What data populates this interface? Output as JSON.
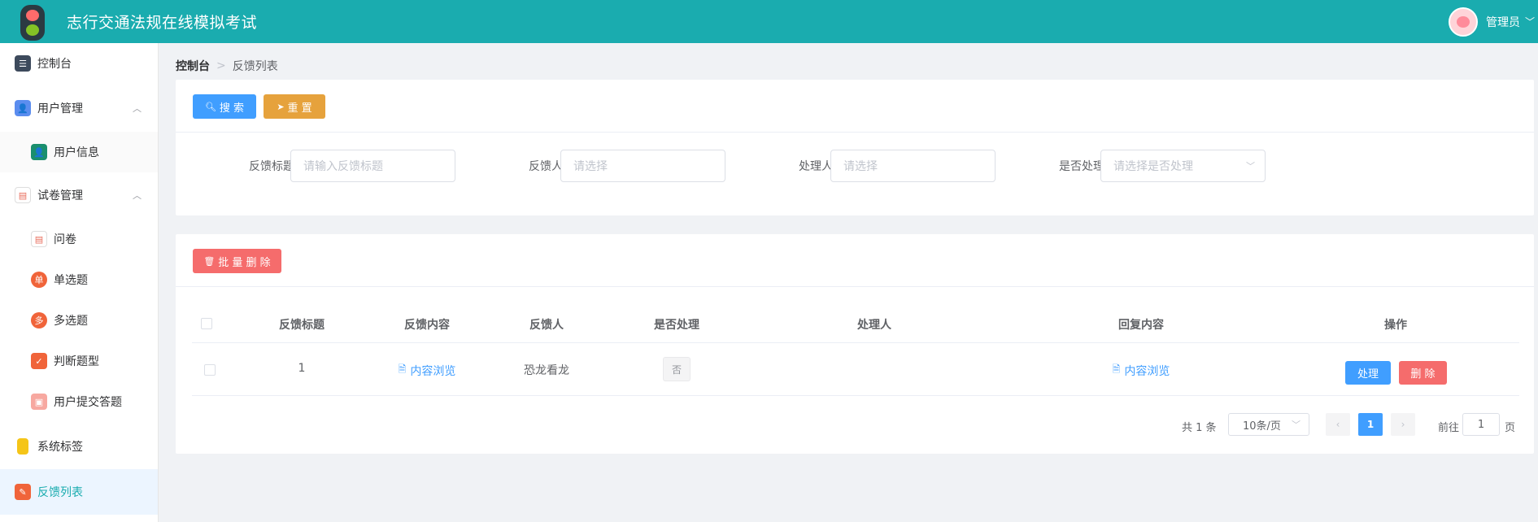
{
  "header": {
    "app_title": "志行交通法规在线模拟考试",
    "user_name": "管理员",
    "user_chevron": "﹀"
  },
  "sidebar": {
    "items": [
      {
        "label": "控制台",
        "icon": "dashboard-icon",
        "icon_color": "#3d4a5c"
      },
      {
        "label": "用户管理",
        "icon": "user-group-icon",
        "icon_color": "#5b8def",
        "arrow": "︿"
      },
      {
        "label": "用户信息",
        "icon": "user-card-icon",
        "icon_color": "#1a8f6e"
      },
      {
        "label": "试卷管理",
        "icon": "paper-icon",
        "icon_color": "#e86b5a",
        "arrow": "︿"
      },
      {
        "label": "问卷",
        "icon": "questionnaire-icon",
        "icon_color": "#e86b5a"
      },
      {
        "label": "单选题",
        "icon": "single-choice-icon",
        "icon_color": "#f0643a",
        "badge": "单"
      },
      {
        "label": "多选题",
        "icon": "multi-choice-icon",
        "icon_color": "#f0643a",
        "badge": "多"
      },
      {
        "label": "判断题型",
        "icon": "judge-icon",
        "icon_color": "#f0643a",
        "badge": "✓"
      },
      {
        "label": "用户提交答题",
        "icon": "submit-icon",
        "icon_color": "#f7a8a0"
      },
      {
        "label": "系统标签",
        "icon": "tag-icon",
        "icon_color": "#f5c518"
      },
      {
        "label": "反馈列表",
        "icon": "feedback-icon",
        "icon_color": "#f0643a"
      }
    ]
  },
  "breadcrumb": {
    "home": "控制台",
    "separator": ">",
    "current": "反馈列表"
  },
  "search_panel": {
    "search_button": "搜 索",
    "reset_button": "重 置",
    "fields": [
      {
        "label": "反馈标题",
        "placeholder": "请输入反馈标题"
      },
      {
        "label": "反馈人",
        "placeholder": "请选择"
      },
      {
        "label": "处理人",
        "placeholder": "请选择"
      },
      {
        "label": "是否处理",
        "placeholder": "请选择是否处理"
      }
    ]
  },
  "table_panel": {
    "batch_delete_button": "批 量 删 除",
    "columns": [
      "反馈标题",
      "反馈内容",
      "反馈人",
      "是否处理",
      "处理人",
      "回复内容",
      "操作"
    ],
    "rows": [
      {
        "title": "1",
        "content_link": "内容浏览",
        "submitter": "恐龙看龙",
        "handled": "否",
        "handler": "",
        "reply_link": "内容浏览",
        "process_button": "处理",
        "delete_button": "删 除"
      }
    ]
  },
  "pagination": {
    "total": "共 1 条",
    "page_size": "10条/页",
    "current_page": "1",
    "goto_prefix": "前往",
    "goto_value": "1",
    "goto_suffix": "页"
  }
}
